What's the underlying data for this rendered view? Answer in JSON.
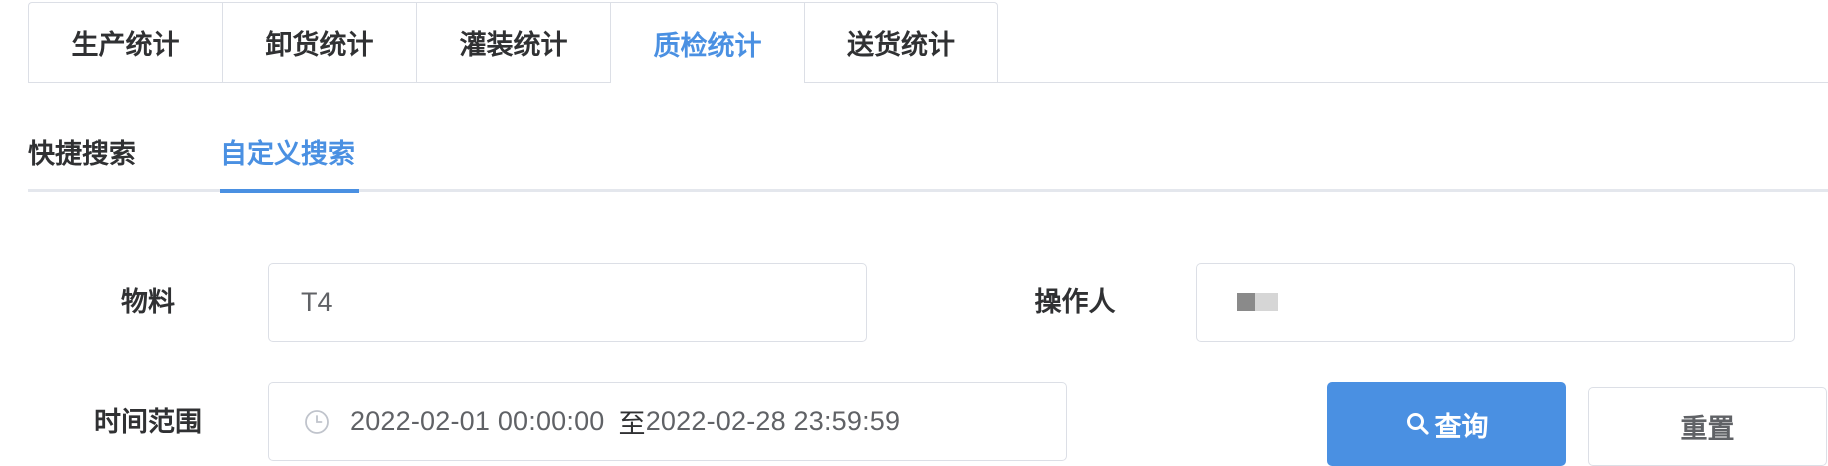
{
  "tabs": [
    {
      "label": "生产统计",
      "active": false
    },
    {
      "label": "卸货统计",
      "active": false
    },
    {
      "label": "灌装统计",
      "active": false
    },
    {
      "label": "质检统计",
      "active": true
    },
    {
      "label": "送货统计",
      "active": false
    }
  ],
  "search_modes": [
    {
      "label": "快捷搜索",
      "active": false
    },
    {
      "label": "自定义搜索",
      "active": true
    }
  ],
  "form": {
    "material": {
      "label": "物料",
      "value": "T4"
    },
    "operator": {
      "label": "操作人"
    },
    "time_range": {
      "label": "时间范围",
      "start": "2022-02-01 00:00:00",
      "separator": "至",
      "end": "2022-02-28 23:59:59"
    }
  },
  "buttons": {
    "query": {
      "label": "查询",
      "icon": "search-icon"
    },
    "reset": {
      "label": "重置"
    }
  },
  "icons": {
    "date_input": "clock-icon"
  },
  "colors": {
    "accent": "#4a90e2",
    "text": "#303133",
    "muted_text": "#606266",
    "border": "#dcdfe6"
  }
}
